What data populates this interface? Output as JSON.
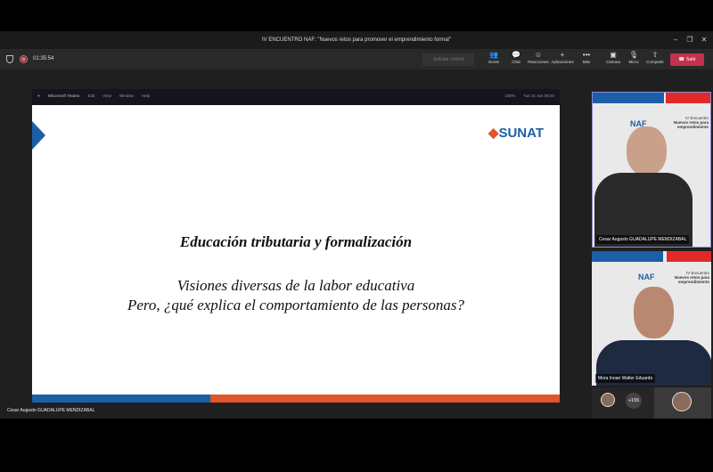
{
  "window": {
    "title": "IV ENCUENTRO NAF: \"Nuevos retos para promover el emprendimiento formal\"",
    "minimize": "–",
    "maximize": "❐",
    "close": "✕"
  },
  "toolbar": {
    "timer": "01:35:54",
    "request_control": "Solicitar control",
    "buttons": [
      {
        "label": "Gente",
        "icon": "people-icon",
        "glyph": "👥"
      },
      {
        "label": "Chat",
        "icon": "chat-icon",
        "glyph": "💬"
      },
      {
        "label": "Reacciones",
        "icon": "reactions-icon",
        "glyph": "☺"
      },
      {
        "label": "Aplicaciones",
        "icon": "apps-icon",
        "glyph": "+"
      },
      {
        "label": "Más",
        "icon": "more-icon",
        "glyph": "•••"
      },
      {
        "label": "Cámara",
        "icon": "camera-off-icon",
        "glyph": "▣"
      },
      {
        "label": "Micro",
        "icon": "mic-off-icon",
        "glyph": "🎙"
      },
      {
        "label": "Compartir",
        "icon": "share-icon",
        "glyph": "⇧"
      }
    ],
    "leave": "Salir",
    "leave_color": "#c4314b"
  },
  "mac_menu": {
    "items": [
      "Microsoft Teams",
      "Edit",
      "View",
      "Window",
      "Help"
    ],
    "clock": "Tue 21 Jun  09:20",
    "battery": "100%"
  },
  "slide": {
    "logo": "SUNAT",
    "title": "Educación tributaria y formalización",
    "line1": "Visiones diversas de la labor educativa",
    "line2": "Pero, ¿qué explica el comportamiento de las personas?",
    "colors": {
      "blue": "#1c5fa8",
      "orange": "#e0552a"
    }
  },
  "presenter_label": "Cesar Augusto GUADALUPE MENDIZABAL",
  "participants": [
    {
      "name": "Cesar Augusto GUADALUPE MENDIZABAL",
      "bg_logo": "NAF",
      "bg_text1": "IV Encuentro",
      "bg_text2": "Nuevos retos para emprendimiento"
    },
    {
      "name": "Mora Inoan Walter Eduardo",
      "bg_logo": "NAF",
      "bg_text1": "IV Encuentro",
      "bg_text2": "Nuevos retos para emprendimiento"
    }
  ],
  "more_participants": "+155"
}
